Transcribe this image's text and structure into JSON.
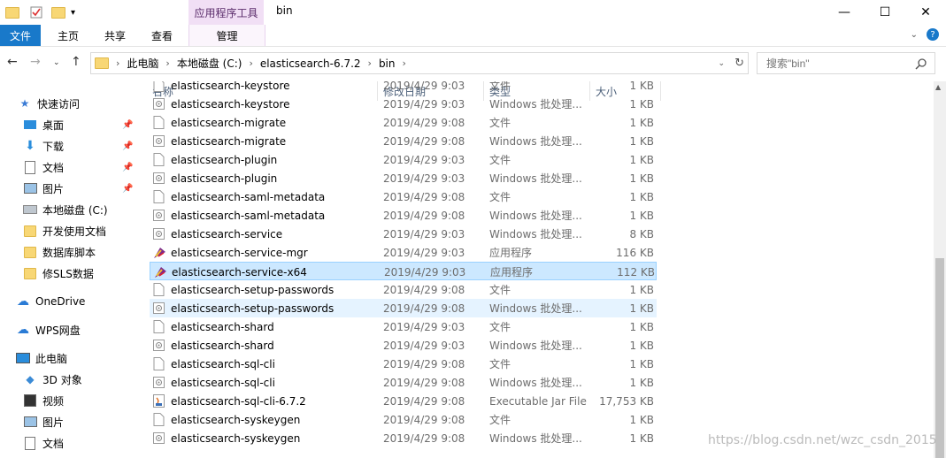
{
  "titlebar": {
    "context_tab": "应用程序工具",
    "window_title": "bin",
    "minimize": "—",
    "maximize": "☐",
    "close": "✕"
  },
  "ribbon": {
    "tabs": [
      "文件",
      "主页",
      "共享",
      "查看",
      "管理"
    ],
    "help": "?"
  },
  "address": {
    "crumbs": [
      "此电脑",
      "本地磁盘 (C:)",
      "elasticsearch-6.7.2",
      "bin"
    ],
    "search_placeholder": "搜索\"bin\""
  },
  "sidebar": {
    "items": [
      {
        "label": "快速访问",
        "icon": "star-icon"
      },
      {
        "label": "桌面",
        "icon": "desktop-icon",
        "pinned": true
      },
      {
        "label": "下载",
        "icon": "download-icon",
        "pinned": true
      },
      {
        "label": "文档",
        "icon": "document-icon",
        "pinned": true
      },
      {
        "label": "图片",
        "icon": "picture-icon",
        "pinned": true
      },
      {
        "label": "本地磁盘 (C:)",
        "icon": "drive-icon"
      },
      {
        "label": "开发使用文档",
        "icon": "folder-icon"
      },
      {
        "label": "数据库脚本",
        "icon": "folder-icon"
      },
      {
        "label": "修SLS数据",
        "icon": "folder-icon"
      },
      {
        "label": "OneDrive",
        "icon": "cloud-icon"
      },
      {
        "label": "WPS网盘",
        "icon": "wps-cloud-icon"
      },
      {
        "label": "此电脑",
        "icon": "pc-icon"
      },
      {
        "label": "3D 对象",
        "icon": "3d-icon"
      },
      {
        "label": "视频",
        "icon": "video-icon"
      },
      {
        "label": "图片",
        "icon": "picture-icon"
      },
      {
        "label": "文档",
        "icon": "document-icon"
      }
    ]
  },
  "columns": {
    "name": "名称",
    "date": "修改日期",
    "type": "类型",
    "size": "大小"
  },
  "files": [
    {
      "name": "elasticsearch-keystore",
      "date": "2019/4/29 9:03",
      "type": "文件",
      "size": "1 KB",
      "icon": "file"
    },
    {
      "name": "elasticsearch-keystore",
      "date": "2019/4/29 9:03",
      "type": "Windows 批处理...",
      "size": "1 KB",
      "icon": "batch"
    },
    {
      "name": "elasticsearch-migrate",
      "date": "2019/4/29 9:08",
      "type": "文件",
      "size": "1 KB",
      "icon": "file"
    },
    {
      "name": "elasticsearch-migrate",
      "date": "2019/4/29 9:08",
      "type": "Windows 批处理...",
      "size": "1 KB",
      "icon": "batch"
    },
    {
      "name": "elasticsearch-plugin",
      "date": "2019/4/29 9:03",
      "type": "文件",
      "size": "1 KB",
      "icon": "file"
    },
    {
      "name": "elasticsearch-plugin",
      "date": "2019/4/29 9:03",
      "type": "Windows 批处理...",
      "size": "1 KB",
      "icon": "batch"
    },
    {
      "name": "elasticsearch-saml-metadata",
      "date": "2019/4/29 9:08",
      "type": "文件",
      "size": "1 KB",
      "icon": "file"
    },
    {
      "name": "elasticsearch-saml-metadata",
      "date": "2019/4/29 9:08",
      "type": "Windows 批处理...",
      "size": "1 KB",
      "icon": "batch"
    },
    {
      "name": "elasticsearch-service",
      "date": "2019/4/29 9:03",
      "type": "Windows 批处理...",
      "size": "8 KB",
      "icon": "batch"
    },
    {
      "name": "elasticsearch-service-mgr",
      "date": "2019/4/29 9:03",
      "type": "应用程序",
      "size": "116 KB",
      "icon": "exe"
    },
    {
      "name": "elasticsearch-service-x64",
      "date": "2019/4/29 9:03",
      "type": "应用程序",
      "size": "112 KB",
      "icon": "exe"
    },
    {
      "name": "elasticsearch-setup-passwords",
      "date": "2019/4/29 9:08",
      "type": "文件",
      "size": "1 KB",
      "icon": "file"
    },
    {
      "name": "elasticsearch-setup-passwords",
      "date": "2019/4/29 9:08",
      "type": "Windows 批处理...",
      "size": "1 KB",
      "icon": "batch"
    },
    {
      "name": "elasticsearch-shard",
      "date": "2019/4/29 9:03",
      "type": "文件",
      "size": "1 KB",
      "icon": "file"
    },
    {
      "name": "elasticsearch-shard",
      "date": "2019/4/29 9:03",
      "type": "Windows 批处理...",
      "size": "1 KB",
      "icon": "batch"
    },
    {
      "name": "elasticsearch-sql-cli",
      "date": "2019/4/29 9:08",
      "type": "文件",
      "size": "1 KB",
      "icon": "file"
    },
    {
      "name": "elasticsearch-sql-cli",
      "date": "2019/4/29 9:08",
      "type": "Windows 批处理...",
      "size": "1 KB",
      "icon": "batch"
    },
    {
      "name": "elasticsearch-sql-cli-6.7.2",
      "date": "2019/4/29 9:08",
      "type": "Executable Jar File",
      "size": "17,753 KB",
      "icon": "jar"
    },
    {
      "name": "elasticsearch-syskeygen",
      "date": "2019/4/29 9:08",
      "type": "文件",
      "size": "1 KB",
      "icon": "file"
    },
    {
      "name": "elasticsearch-syskeygen",
      "date": "2019/4/29 9:08",
      "type": "Windows 批处理...",
      "size": "1 KB",
      "icon": "batch"
    }
  ],
  "selected_index": 10,
  "hover_index": 12,
  "watermark": "https://blog.csdn.net/wzc_csdn_2015",
  "colors": {
    "accent": "#1979ca",
    "selection": "#cce8ff",
    "context_tab": "#f1dff5"
  }
}
